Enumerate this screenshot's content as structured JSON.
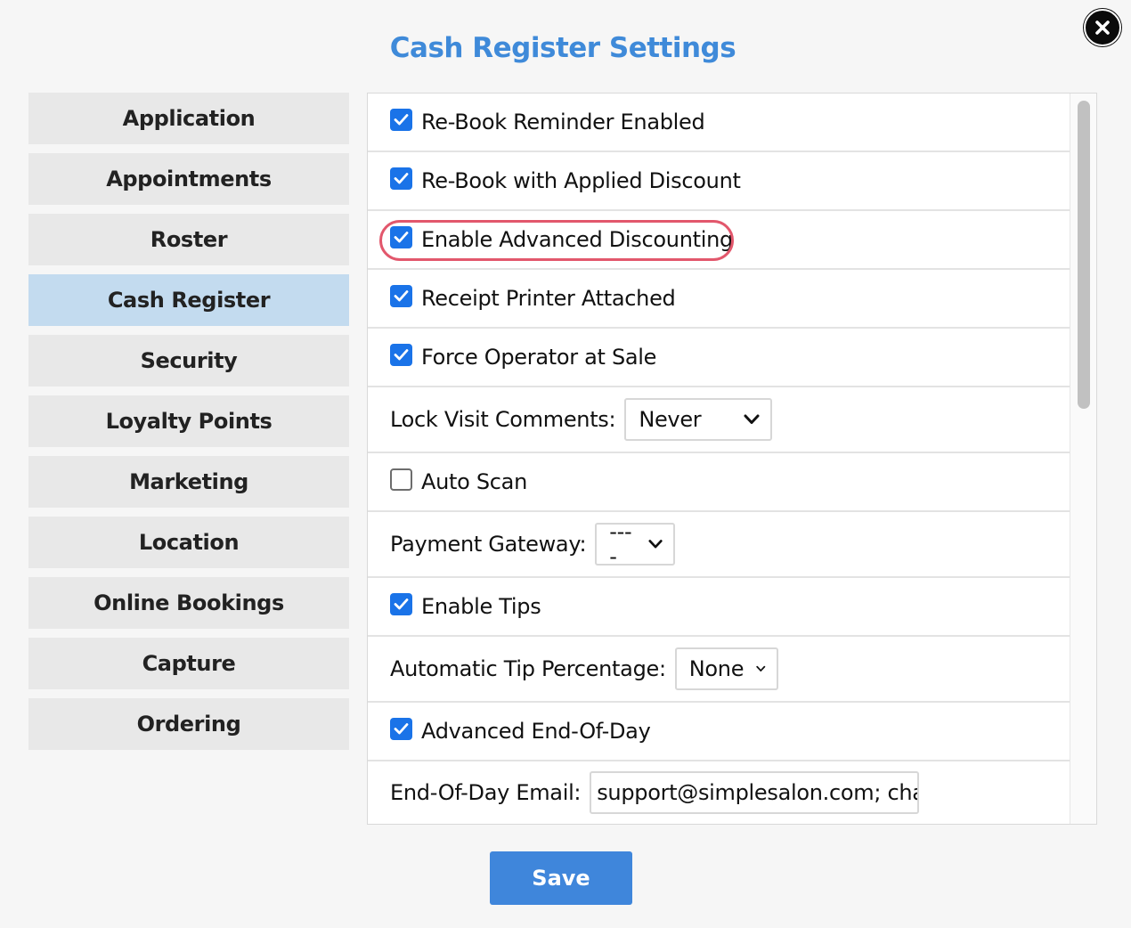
{
  "dialog": {
    "title": "Cash Register Settings",
    "save_label": "Save",
    "accent_color": "#3f8ad9",
    "close_icon": "close-icon"
  },
  "sidebar": {
    "active_index": 3,
    "items": [
      {
        "label": "Application"
      },
      {
        "label": "Appointments"
      },
      {
        "label": "Roster"
      },
      {
        "label": "Cash Register"
      },
      {
        "label": "Security"
      },
      {
        "label": "Loyalty Points"
      },
      {
        "label": "Marketing"
      },
      {
        "label": "Location"
      },
      {
        "label": "Online Bookings"
      },
      {
        "label": "Capture"
      },
      {
        "label": "Ordering"
      }
    ]
  },
  "settings": {
    "rebook_reminder": {
      "label": "Re-Book Reminder Enabled",
      "checked": true
    },
    "rebook_discount": {
      "label": "Re-Book with Applied Discount",
      "checked": true
    },
    "advanced_discounting": {
      "label": "Enable Advanced Discounting",
      "checked": true,
      "highlighted": true
    },
    "receipt_printer": {
      "label": "Receipt Printer Attached",
      "checked": true
    },
    "force_operator": {
      "label": "Force Operator at Sale",
      "checked": true
    },
    "lock_visit_comments": {
      "label": "Lock Visit Comments:",
      "value": "Never"
    },
    "auto_scan": {
      "label": "Auto Scan",
      "checked": false
    },
    "payment_gateway": {
      "label": "Payment Gateway:",
      "value": "----"
    },
    "enable_tips": {
      "label": "Enable Tips",
      "checked": true
    },
    "auto_tip_percentage": {
      "label": "Automatic Tip Percentage:",
      "value": "None"
    },
    "advanced_eod": {
      "label": "Advanced End-Of-Day",
      "checked": true
    },
    "eod_email": {
      "label": "End-Of-Day Email:",
      "value": "support@simplesalon.com; chai"
    }
  }
}
